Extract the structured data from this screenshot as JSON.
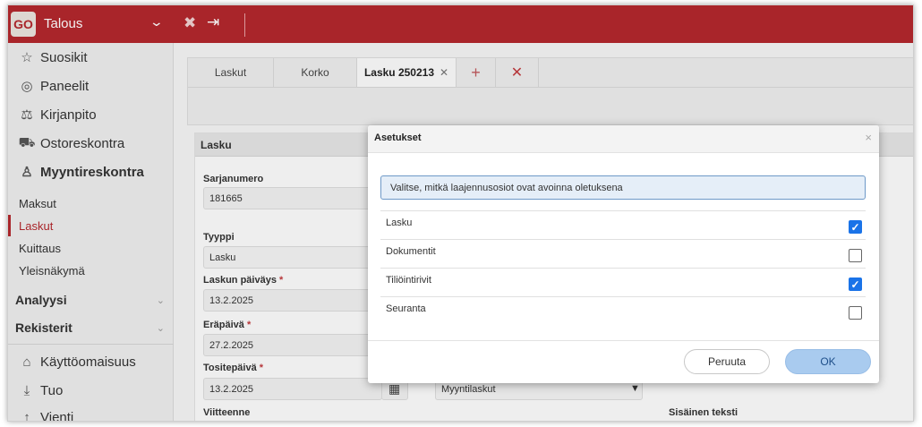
{
  "app": {
    "logo": "GO",
    "title": "Talous"
  },
  "toolbar_icons": [
    "close-all-tabs-icon",
    "logout-icon"
  ],
  "sidebar": {
    "top_items": [
      {
        "label": "Suosikit",
        "icon": "star-icon"
      },
      {
        "label": "Paneelit",
        "icon": "dashboard-icon"
      },
      {
        "label": "Kirjanpito",
        "icon": "scales-icon"
      },
      {
        "label": "Ostoreskontra",
        "icon": "truck-icon"
      },
      {
        "label": "Myyntireskontra",
        "icon": "user-icon"
      }
    ],
    "sub_items": [
      {
        "label": "Maksut"
      },
      {
        "label": "Laskut"
      },
      {
        "label": "Kuittaus"
      },
      {
        "label": "Yleisnäkymä"
      }
    ],
    "groups": [
      {
        "label": "Analyysi"
      },
      {
        "label": "Rekisterit"
      }
    ],
    "bottom_items": [
      {
        "label": "Käyttöomaisuus",
        "icon": "assets-icon"
      },
      {
        "label": "Tuo",
        "icon": "import-icon"
      },
      {
        "label": "Vienti",
        "icon": "export-icon"
      }
    ],
    "active_sub": "Laskut"
  },
  "tabs": [
    {
      "label": "Laskut"
    },
    {
      "label": "Korko"
    },
    {
      "label": "Lasku 250213",
      "close": "✕"
    },
    {
      "label": "+"
    },
    {
      "label": "✕"
    }
  ],
  "form": {
    "header": "Lasku",
    "sarjanumero_label": "Sarjanumero",
    "sarjanumero_value": "181665",
    "tyyppi_label": "Tyyppi",
    "tyyppi_value": "Lasku",
    "laskun_paivays_label": "Laskun päiväys",
    "laskun_paivays_value": "13.2.2025",
    "erapaiva_label": "Eräpäivä",
    "erapaiva_value": "27.2.2025",
    "tositepaiva_label": "Tositepäivä",
    "tositepaiva_value": "13.2.2025",
    "tositelaji_value": "Myyntilaskut",
    "viitteenne_label": "Viitteenne",
    "sisainen_teksti_label": "Sisäinen teksti",
    "required_mark": "*"
  },
  "dialog": {
    "title": "Asetukset",
    "close": "×",
    "info": "Valitse, mitkä laajennusosiot ovat avoinna oletuksena",
    "options": [
      {
        "label": "Lasku",
        "checked": true
      },
      {
        "label": "Dokumentit",
        "checked": false
      },
      {
        "label": "Tiliöintirivit",
        "checked": true
      },
      {
        "label": "Seuranta",
        "checked": false
      }
    ],
    "cancel_label": "Peruuta",
    "ok_label": "OK"
  }
}
